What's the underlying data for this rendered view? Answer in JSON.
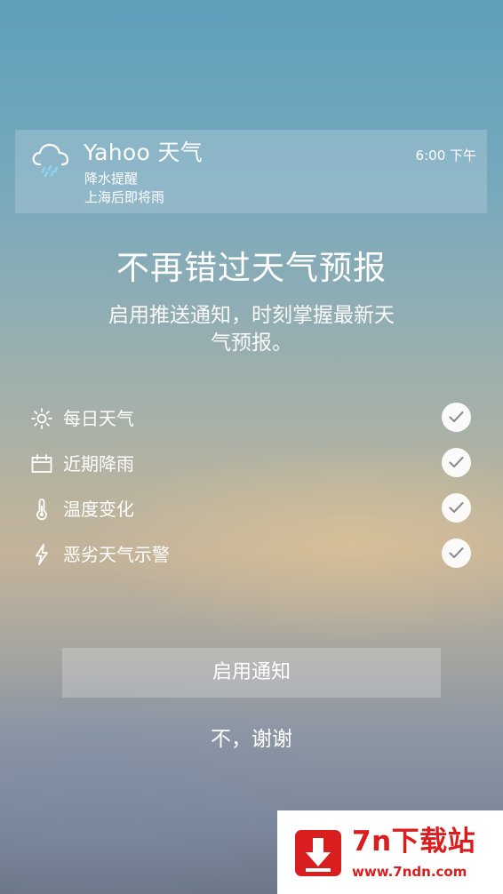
{
  "notification": {
    "app_name": "Yahoo 天气",
    "title": "降水提醒",
    "body": "上海后即将雨",
    "time": "6:00 下午",
    "icon": "rain-cloud-icon"
  },
  "headline": "不再错过天气预报",
  "subline": "启用推送通知，时刻掌握最新天气预报。",
  "features": [
    {
      "label": "每日天气",
      "icon": "sun-icon",
      "checked": true
    },
    {
      "label": "近期降雨",
      "icon": "calendar-icon",
      "checked": true
    },
    {
      "label": "温度变化",
      "icon": "thermometer-icon",
      "checked": true
    },
    {
      "label": "恶劣天气示警",
      "icon": "lightning-icon",
      "checked": true
    }
  ],
  "buttons": {
    "enable": "启用通知",
    "decline": "不，谢谢"
  },
  "watermark": {
    "title": "7n下载站",
    "url": "www.7ndn.com"
  },
  "colors": {
    "watermark_red": "#d81e1e",
    "check_gray": "#8a8a8a"
  }
}
